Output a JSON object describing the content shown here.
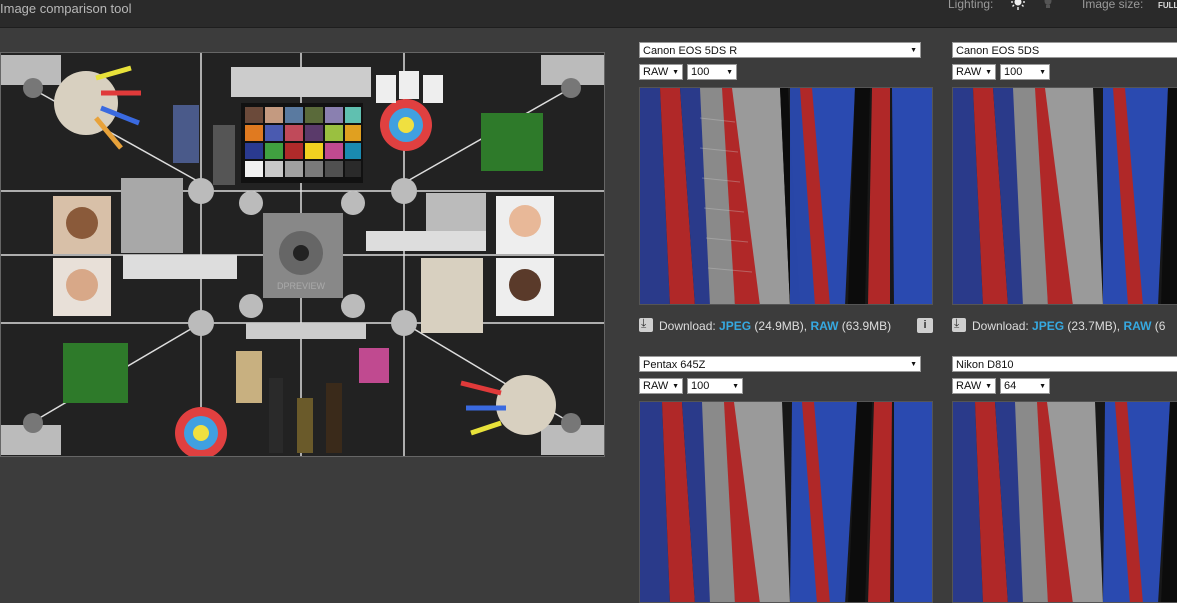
{
  "header": {
    "title": "Image comparison tool",
    "lighting_label": "Lighting:",
    "image_size_label": "Image size:",
    "image_size_value": "FULL",
    "icons": [
      "sun-icon",
      "bulb-icon"
    ]
  },
  "panels": [
    {
      "camera": "Canon EOS 5DS R",
      "format": "RAW",
      "iso": "100",
      "download": {
        "label": "Download:",
        "jpeg": "JPEG",
        "jpeg_size": "(24.9MB),",
        "raw": "RAW",
        "raw_size": "(63.9MB)"
      }
    },
    {
      "camera": "Canon EOS 5DS",
      "format": "RAW",
      "iso": "100",
      "download": {
        "label": "Download:",
        "jpeg": "JPEG",
        "jpeg_size": "(23.7MB),",
        "raw": "RAW",
        "raw_size": "(6"
      }
    },
    {
      "camera": "Pentax 645Z",
      "format": "RAW",
      "iso": "100"
    },
    {
      "camera": "Nikon D810",
      "format": "RAW",
      "iso": "64"
    }
  ],
  "scene": {
    "watermark": "DPREVIEW"
  },
  "colors": {
    "accent_link": "#36a9e1",
    "background": "#3c3c3c",
    "header": "#2a2a2a"
  }
}
